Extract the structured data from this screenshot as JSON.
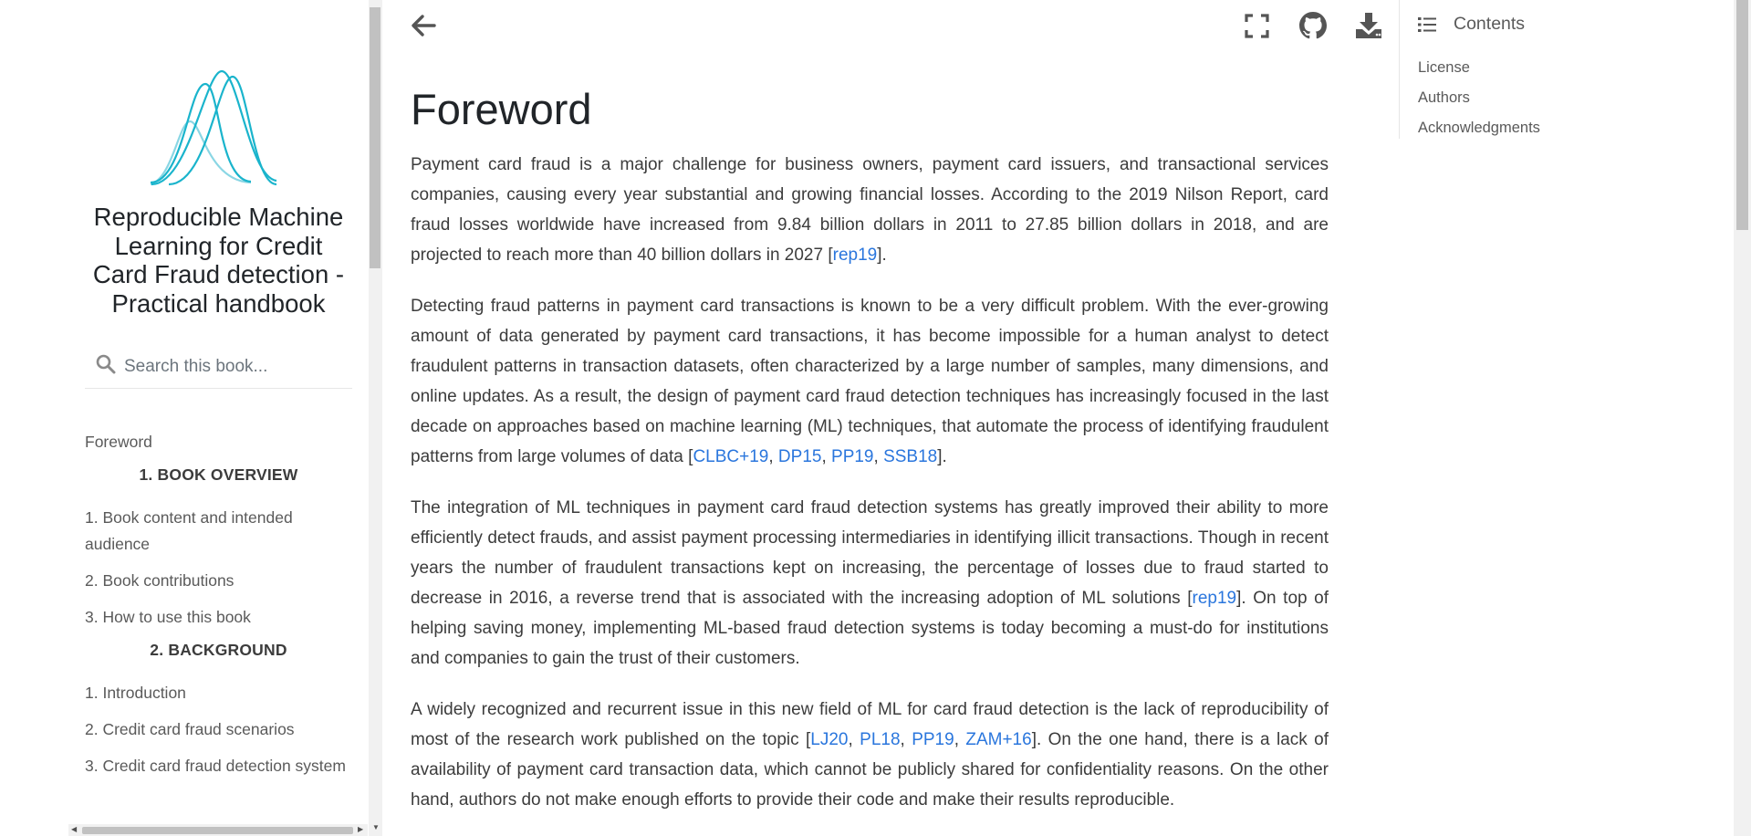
{
  "sidebar": {
    "book_title": "Reproducible Machine Learning for Credit Card Fraud detection - Practical handbook",
    "search": {
      "placeholder": "Search this book..."
    },
    "nav": {
      "foreword": "Foreword",
      "caption_1": "1. BOOK OVERVIEW",
      "section_1": [
        "1. Book content and intended audience",
        "2. Book contributions",
        "3. How to use this book"
      ],
      "caption_2": "2. BACKGROUND",
      "section_2": [
        "1. Introduction",
        "2. Credit card fraud scenarios",
        "3. Credit card fraud detection system"
      ]
    }
  },
  "toolbar": {
    "icons": [
      "back-arrow-icon",
      "fullscreen-icon",
      "github-icon",
      "download-icon"
    ]
  },
  "main": {
    "title": "Foreword",
    "paragraphs": [
      [
        {
          "t": "Payment card fraud is a major challenge for business owners, payment card issuers, and transactional services companies, causing every year substantial and growing financial losses. According to the 2019 Nilson Report, card fraud losses worldwide have increased from 9.84 billion dollars in 2011 to 27.85 billion dollars in 2018, and are projected to reach more than 40 billion dollars in 2027 ["
        },
        {
          "t": "rep19",
          "link": true
        },
        {
          "t": "]."
        }
      ],
      [
        {
          "t": "Detecting fraud patterns in payment card transactions is known to be a very difficult problem. With the ever-growing amount of data generated by payment card transactions, it has become impossible for a human analyst to detect fraudulent patterns in transaction datasets, often characterized by a large number of samples, many dimensions, and online updates. As a result, the design of payment card fraud detection techniques has increasingly focused in the last decade on approaches based on machine learning (ML) techniques, that automate the process of identifying fraudulent patterns from large volumes of data ["
        },
        {
          "t": "CLBC+19",
          "link": true
        },
        {
          "t": ", "
        },
        {
          "t": "DP15",
          "link": true
        },
        {
          "t": ", "
        },
        {
          "t": "PP19",
          "link": true
        },
        {
          "t": ", "
        },
        {
          "t": "SSB18",
          "link": true
        },
        {
          "t": "]."
        }
      ],
      [
        {
          "t": "The integration of ML techniques in payment card fraud detection systems has greatly improved their ability to more efficiently detect frauds, and assist payment processing intermediaries in identifying illicit transactions. Though in recent years the number of fraudulent transactions kept on increasing, the percentage of losses due to fraud started to decrease in 2016, a reverse trend that is associated with the increasing adoption of ML solutions ["
        },
        {
          "t": "rep19",
          "link": true
        },
        {
          "t": "]. On top of helping saving money, implementing ML-based fraud detection systems is today becoming a must-do for institutions and companies to gain the trust of their customers."
        }
      ],
      [
        {
          "t": "A widely recognized and recurrent issue in this new field of ML for card fraud detection is the lack of reproducibility of most of the research work published on the topic ["
        },
        {
          "t": "LJ20",
          "link": true
        },
        {
          "t": ", "
        },
        {
          "t": "PL18",
          "link": true
        },
        {
          "t": ", "
        },
        {
          "t": "PP19",
          "link": true
        },
        {
          "t": ", "
        },
        {
          "t": "ZAM+16",
          "link": true
        },
        {
          "t": "]. On the one hand, there is a lack of availability of payment card transaction data, which cannot be publicly shared for confidentiality reasons. On the other hand, authors do not make enough efforts to provide their code and make their results reproducible."
        }
      ]
    ]
  },
  "toc": {
    "title": "Contents",
    "items": [
      "License",
      "Authors",
      "Acknowledgments"
    ]
  },
  "colors": {
    "link": "#2a76dd",
    "logo": "#1ab4cc",
    "logo_light": "#8ad6e4",
    "text": "#3c3c3c"
  }
}
